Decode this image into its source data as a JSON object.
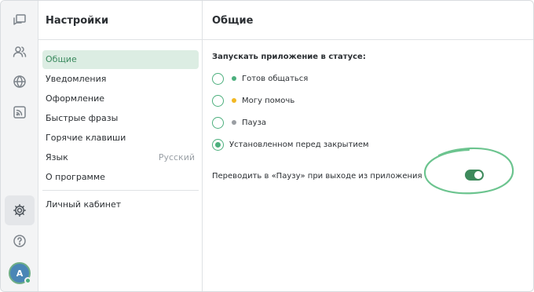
{
  "rail": {
    "icons": [
      "chat-icon",
      "contacts-icon",
      "globe-icon",
      "rss-icon",
      "settings-icon",
      "help-icon"
    ],
    "avatar_initial": "A"
  },
  "menu": {
    "title": "Настройки",
    "items": [
      {
        "label": "Общие",
        "active": true
      },
      {
        "label": "Уведомления"
      },
      {
        "label": "Оформление"
      },
      {
        "label": "Быстрые фразы"
      },
      {
        "label": "Горячие клавиши"
      },
      {
        "label": "Язык",
        "hint": "Русский"
      },
      {
        "label": "О программе"
      }
    ],
    "account": "Личный кабинет"
  },
  "main": {
    "title": "Общие",
    "section_label": "Запускать приложение в статусе:",
    "statuses": [
      {
        "label": "Готов общаться",
        "dot_color": "#4caf7d",
        "selected": false
      },
      {
        "label": "Могу помочь",
        "dot_color": "#f2b824",
        "selected": false
      },
      {
        "label": "Пауза",
        "dot_color": "#9a9ea3",
        "selected": false
      },
      {
        "label": "Установленном перед закрытием",
        "selected": true
      }
    ],
    "pause_toggle_label": "Переводить в «Паузу» при выходе из приложения",
    "pause_toggle_on": true
  },
  "colors": {
    "accent": "#4caf7d",
    "active_menu_bg": "#dcede3",
    "annotation": "#6cc48f"
  }
}
